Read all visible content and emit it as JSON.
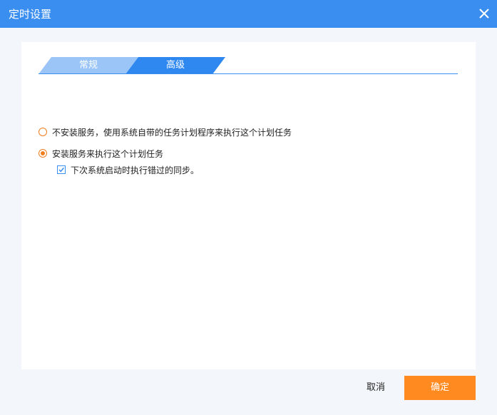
{
  "dialog": {
    "title": "定时设置",
    "close_icon": "close-icon"
  },
  "tabs": [
    {
      "label": "常规",
      "active": false
    },
    {
      "label": "高级",
      "active": true
    }
  ],
  "options": {
    "no_service": {
      "label": "不安装服务，使用系统自带的任务计划程序来执行这个计划任务",
      "checked": false
    },
    "install_service": {
      "label": "安装服务来执行这个计划任务",
      "checked": true
    },
    "catch_up": {
      "label": "下次系统启动时执行错过的同步。",
      "checked": true
    }
  },
  "buttons": {
    "cancel": "取消",
    "ok": "确定"
  },
  "colors": {
    "title_bar": "#3a8ef0",
    "tab_active": "#2f88ef",
    "tab_inactive": "#9ac5f6",
    "accent_orange": "#ff8a1f",
    "radio_orange": "#f07d1e"
  }
}
